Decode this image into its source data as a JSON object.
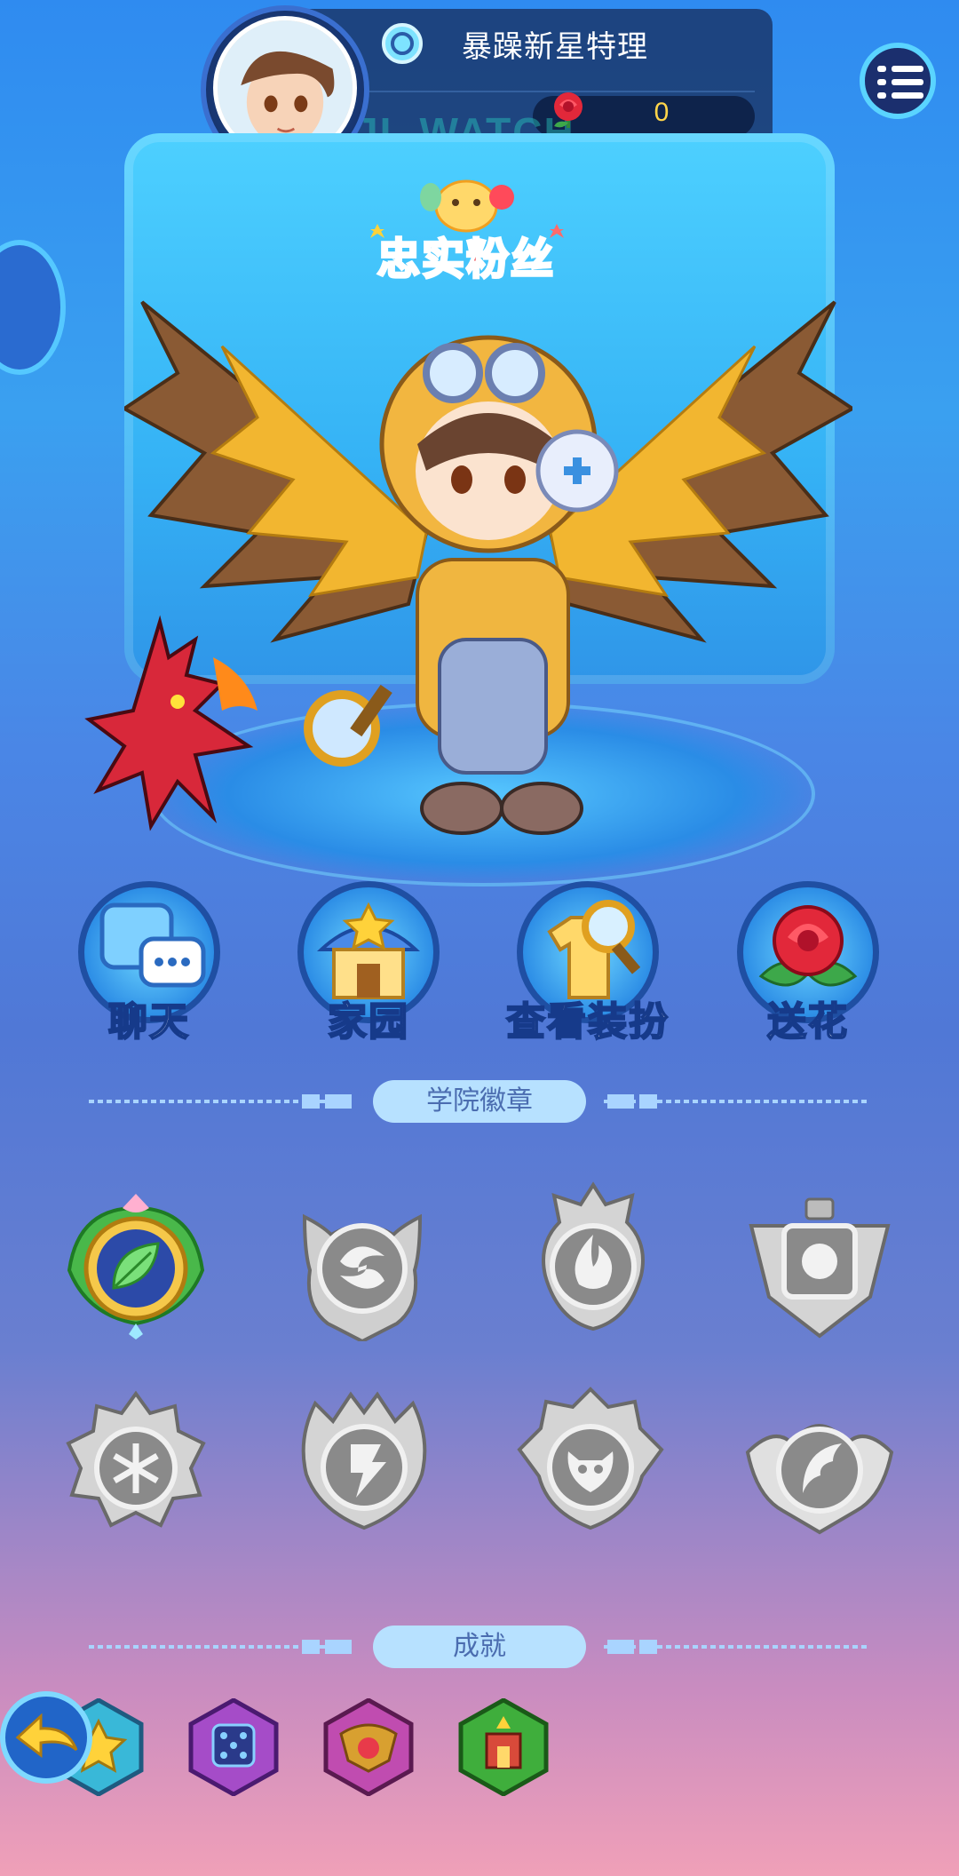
{
  "header": {
    "player_name": "暴躁新星特理",
    "rose_count": "0",
    "watermark": "JL.WATCH"
  },
  "banner": {
    "title": "忠实粉丝"
  },
  "actions": [
    {
      "label": "聊天",
      "icon": "chat-icon"
    },
    {
      "label": "家园",
      "icon": "home-icon"
    },
    {
      "label": "查看装扮",
      "icon": "view-outfit-icon"
    },
    {
      "label": "送花",
      "icon": "rose-gift-icon"
    }
  ],
  "sections": {
    "badges_title": "学院徽章",
    "achievements_title": "成就"
  },
  "badges": [
    {
      "icon": "leaf-badge-icon",
      "unlocked": true
    },
    {
      "icon": "swirl-badge-icon",
      "unlocked": false
    },
    {
      "icon": "flame-badge-icon",
      "unlocked": false
    },
    {
      "icon": "square-badge-icon",
      "unlocked": false
    },
    {
      "icon": "snowflake-badge-icon",
      "unlocked": false
    },
    {
      "icon": "lightning-badge-icon",
      "unlocked": false
    },
    {
      "icon": "demon-badge-icon",
      "unlocked": false
    },
    {
      "icon": "wing-badge-icon",
      "unlocked": false
    }
  ],
  "achievements": [
    {
      "icon": "star-achievement-icon",
      "color": "#39b8d8"
    },
    {
      "icon": "dice-achievement-icon",
      "color": "#a54cc8"
    },
    {
      "icon": "crest-achievement-icon",
      "color": "#c04cb0"
    },
    {
      "icon": "tower-achievement-icon",
      "color": "#3fae3c"
    }
  ],
  "colors": {
    "accent": "#5ad4ff",
    "badge_unlocked": "#2c4aa8",
    "badge_locked": "#9a9a9a"
  }
}
